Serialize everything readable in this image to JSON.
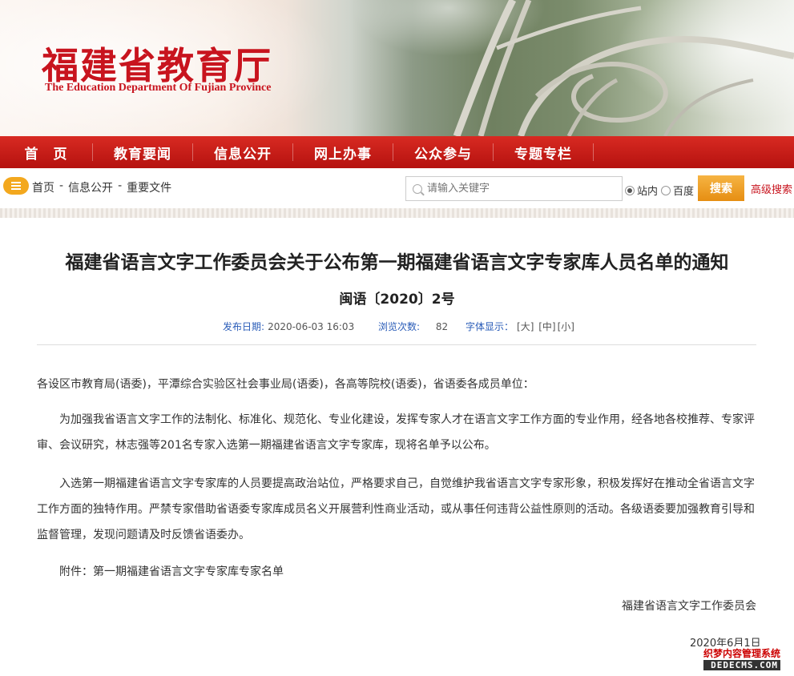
{
  "header": {
    "logo_cn": "福建省教育厅",
    "logo_en": "The Education Department Of Fujian Province"
  },
  "nav": {
    "items": [
      {
        "label": "首　页"
      },
      {
        "label": "教育要闻"
      },
      {
        "label": "信息公开"
      },
      {
        "label": "网上办事"
      },
      {
        "label": "公众参与"
      },
      {
        "label": "专题专栏"
      }
    ]
  },
  "breadcrumb": [
    "首页",
    "-",
    "信息公开",
    "-",
    "重要文件"
  ],
  "search": {
    "placeholder": "请输入关键字",
    "scope_options": [
      {
        "label": "站内",
        "checked": true
      },
      {
        "label": "百度",
        "checked": false
      }
    ],
    "button_label": "搜索",
    "advanced_label": "高级搜索"
  },
  "article": {
    "title": "福建省语言文字工作委员会关于公布第一期福建省语言文字专家库人员名单的通知",
    "doc_number": "闽语〔2020〕2号",
    "meta": {
      "publish_label": "发布日期:",
      "publish_date": "2020-06-03 16:03",
      "views_label": "浏览次数:",
      "views": "82",
      "font_label": "字体显示：",
      "font_large": "[大]",
      "font_medium": "[中]",
      "font_small": "[小]"
    },
    "paragraphs": [
      "各设区市教育局(语委)，平潭综合实验区社会事业局(语委)，各高等院校(语委)，省语委各成员单位：",
      "　　为加强我省语言文字工作的法制化、标准化、规范化、专业化建设，发挥专家人才在语言文字工作方面的专业作用，经各地各校推荐、专家评审、会议研究，林志强等201名专家入选第一期福建省语言文字专家库，现将名单予以公布。",
      "　　入选第一期福建省语言文字专家库的人员要提高政治站位，严格要求自己，自觉维护我省语言文字专家形象，积极发挥好在推动全省语言文字工作方面的独特作用。严禁专家借助省语委专家库成员名义开展营利性商业活动，或从事任何违背公益性原则的活动。各级语委要加强教育引导和监督管理，发现问题请及时反馈省语委办。",
      "　　附件：第一期福建省语言文字专家库专家名单"
    ],
    "signature": "福建省语言文字工作委员会",
    "date": "2020年6月1日"
  },
  "watermark": {
    "line1": "织梦内容管理系统",
    "line2": "DEDECMS.COM"
  },
  "colors": {
    "brand_red": "#c8141e",
    "nav_red": "#c51a16",
    "search_orange": "#f0a02a",
    "meta_blue": "#2a5cb8"
  }
}
